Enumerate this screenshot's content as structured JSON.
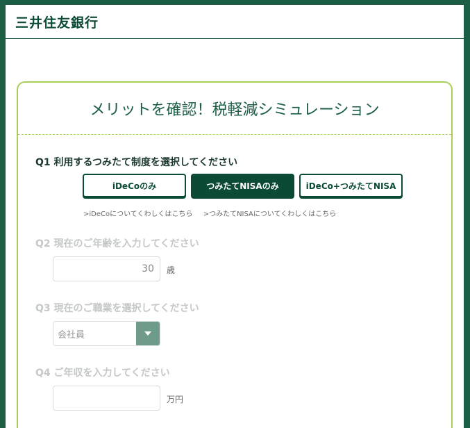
{
  "header": {
    "logo": "三井住友銀行"
  },
  "card": {
    "title": "メリットを確認！税軽減シミュレーション"
  },
  "q1": {
    "label": "Q1 利用するつみたて制度を選択してください",
    "options": [
      "iDeCoのみ",
      "つみたてNISAのみ",
      "iDeCo+つみたてNISA"
    ],
    "selected": "つみたてNISAのみ",
    "links": [
      ">iDeCoについてくわしくはこちら",
      ">つみたてNISAについてくわしくはこちら"
    ]
  },
  "q2": {
    "label": "Q2 現在のご年齢を入力してください",
    "value": "30",
    "unit": "歳"
  },
  "q3": {
    "label": "Q3 現在のご職業を選択してください",
    "value": "会社員"
  },
  "q4": {
    "label": "Q4 ご年収を入力してください",
    "value": "",
    "unit": "万円"
  },
  "colors": {
    "brand": "#0b4a35",
    "accent": "#a8cf57",
    "frame": "#1b5e44"
  }
}
